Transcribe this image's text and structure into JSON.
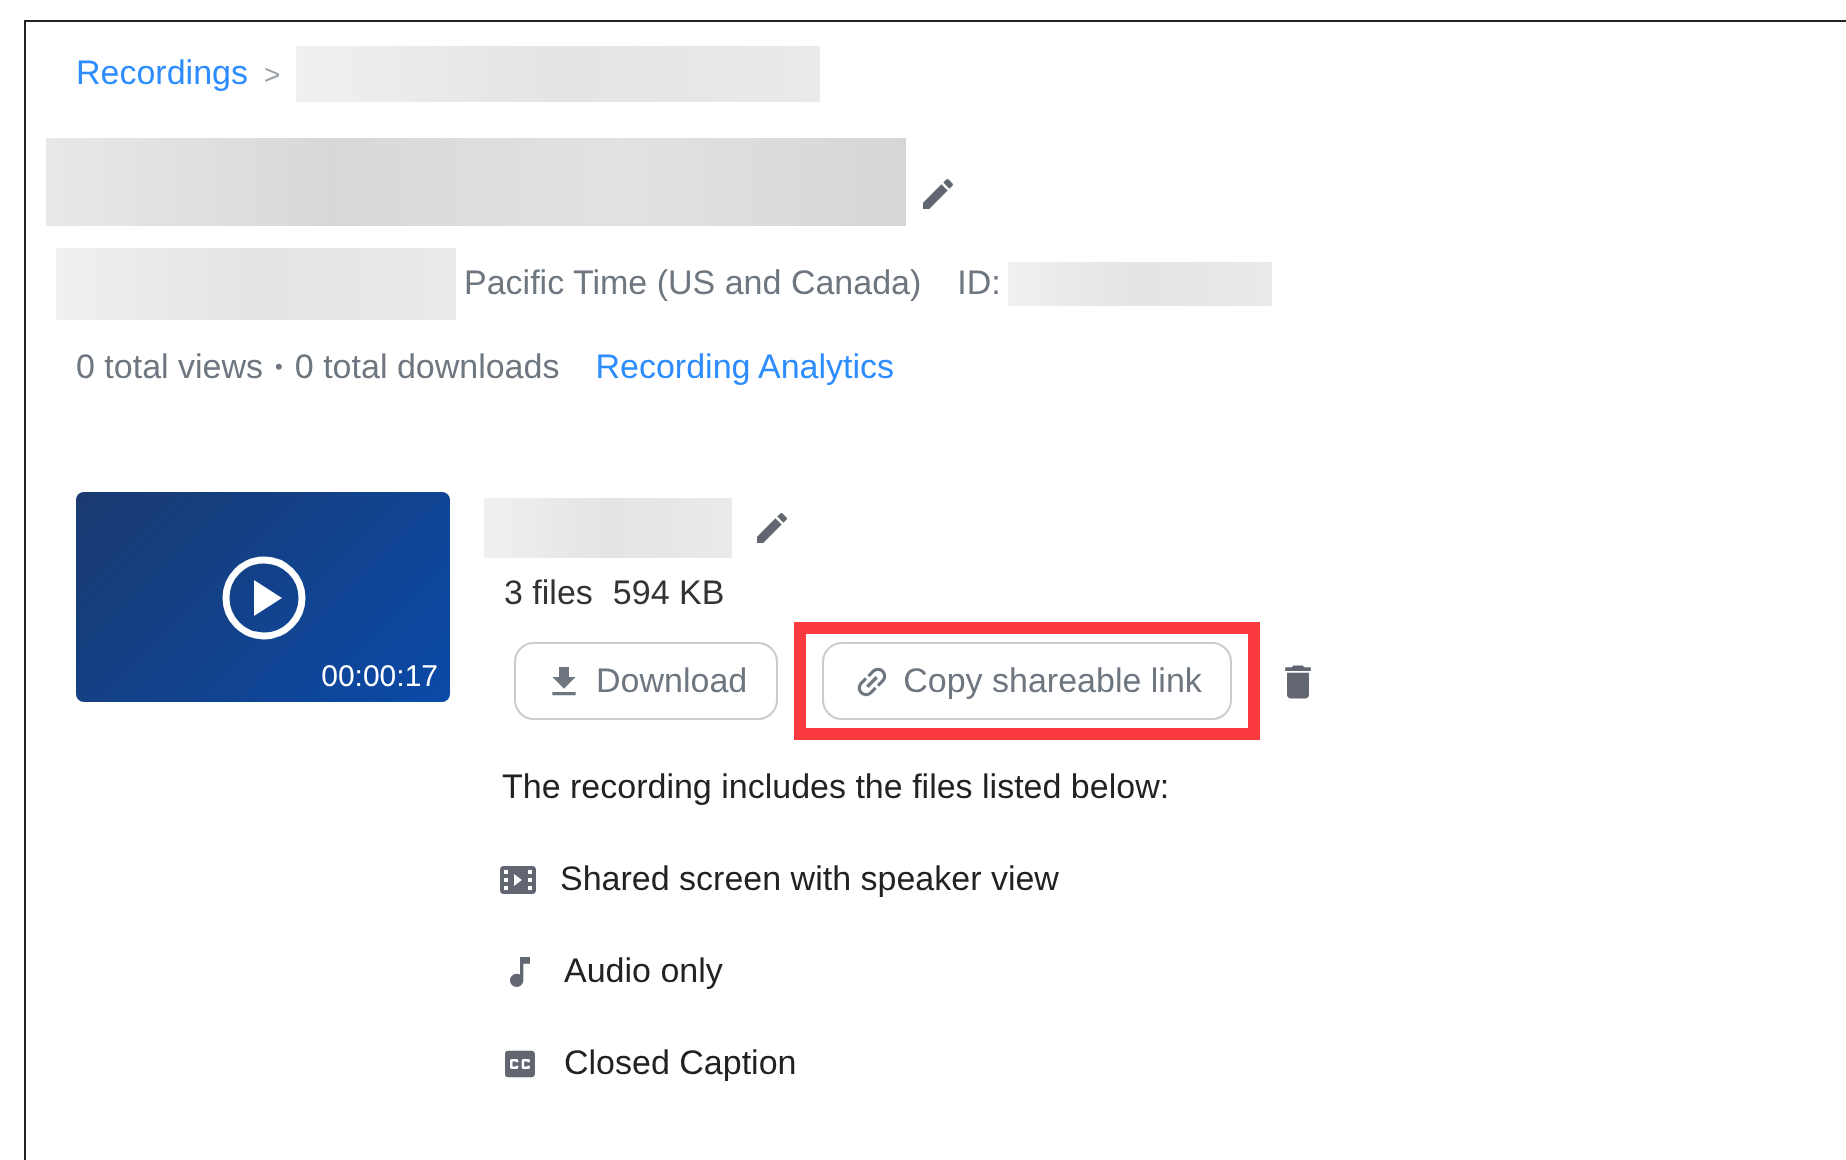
{
  "breadcrumb": {
    "link": "Recordings",
    "separator": ">"
  },
  "meeting": {
    "timezone": "Pacific Time (US and Canada)",
    "id_label": "ID:"
  },
  "stats": {
    "views": "0 total views",
    "separator": "•",
    "downloads": "0 total downloads",
    "analytics_link": "Recording Analytics"
  },
  "recording": {
    "duration": "00:00:17",
    "files_count": "3 files",
    "size": "594 KB",
    "buttons": [
      {
        "kind": "download",
        "label": "Download",
        "highlighted": false
      },
      {
        "kind": "link",
        "label": "Copy shareable link",
        "highlighted": true
      }
    ],
    "files_heading": "The recording includes the files listed below:",
    "files": [
      {
        "kind": "video",
        "label": "Shared screen with speaker view"
      },
      {
        "kind": "audio",
        "label": "Audio only"
      },
      {
        "kind": "caption",
        "label": "Closed Caption"
      }
    ]
  }
}
